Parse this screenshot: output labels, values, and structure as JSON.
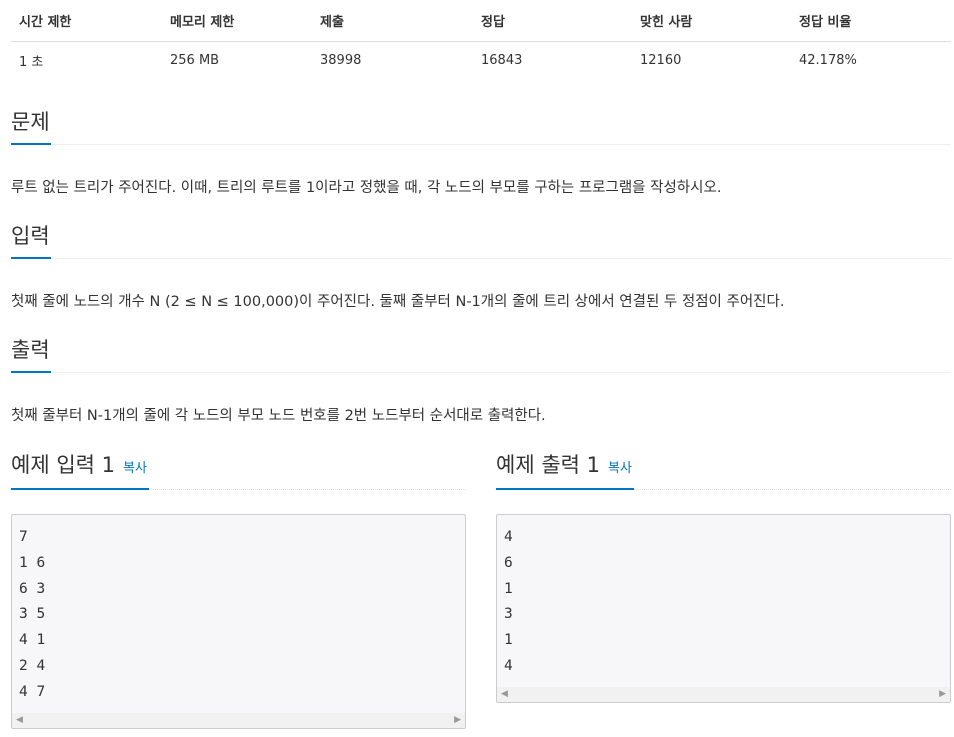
{
  "stats": {
    "headers": [
      "시간 제한",
      "메모리 제한",
      "제출",
      "정답",
      "맞힌 사람",
      "정답 비율"
    ],
    "values": [
      "1 초",
      "256 MB",
      "38998",
      "16843",
      "12160",
      "42.178%"
    ]
  },
  "problem": {
    "title": "문제",
    "text": "루트 없는 트리가 주어진다. 이때, 트리의 루트를 1이라고 정했을 때, 각 노드의 부모를 구하는 프로그램을 작성하시오."
  },
  "input": {
    "title": "입력",
    "text": "첫째 줄에 노드의 개수 N (2 ≤ N ≤ 100,000)이 주어진다. 둘째 줄부터 N-1개의 줄에 트리 상에서 연결된 두 정점이 주어진다."
  },
  "output": {
    "title": "출력",
    "text": "첫째 줄부터 N-1개의 줄에 각 노드의 부모 노드 번호를 2번 노드부터 순서대로 출력한다."
  },
  "sample_input": {
    "title": "예제 입력 1",
    "copy_label": "복사",
    "lines": [
      "7",
      "1 6",
      "6 3",
      "3 5",
      "4 1",
      "2 4",
      "4 7"
    ]
  },
  "sample_output": {
    "title": "예제 출력 1",
    "copy_label": "복사",
    "lines": [
      "4",
      "6",
      "1",
      "3",
      "1",
      "4"
    ]
  },
  "accent_color": "#0076c0"
}
